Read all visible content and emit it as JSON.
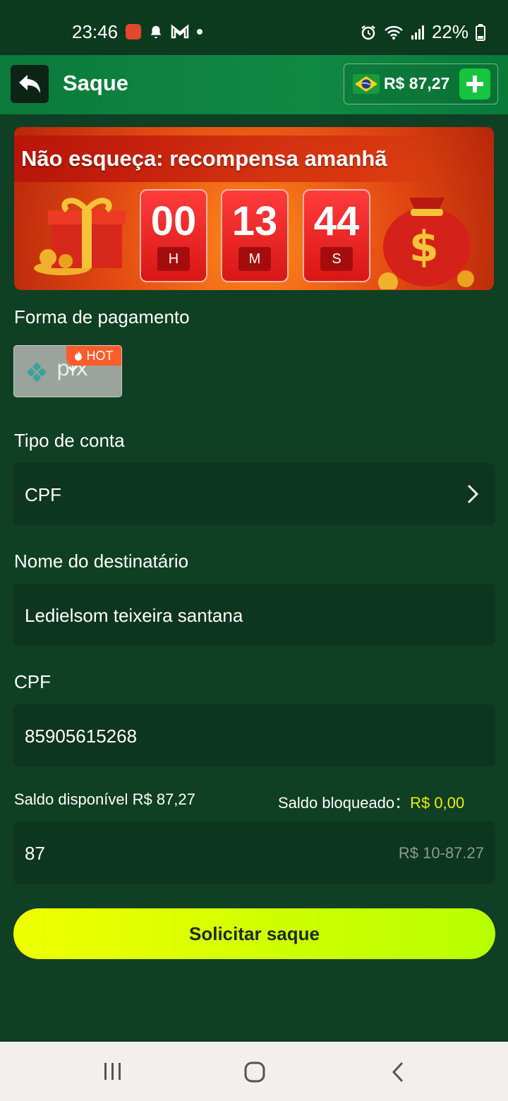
{
  "status_bar": {
    "time": "23:46",
    "battery": "22%",
    "icons_left": [
      "notification-app-icon",
      "bell-icon",
      "gmail-icon",
      "dot-icon"
    ],
    "icons_right": [
      "alarm-icon",
      "wifi-icon",
      "signal-icon",
      "battery-icon"
    ]
  },
  "header": {
    "title": "Saque",
    "balance": "R$ 87,27"
  },
  "banner": {
    "title": "Não esqueça: recompensa amanhã",
    "timer": [
      {
        "value": "00",
        "unit": "H"
      },
      {
        "value": "13",
        "unit": "M"
      },
      {
        "value": "44",
        "unit": "S"
      }
    ]
  },
  "payment": {
    "label": "Forma de pagamento",
    "method": "pix",
    "hot_tag": "HOT"
  },
  "account_type": {
    "label": "Tipo de conta",
    "value": "CPF"
  },
  "recipient": {
    "label": "Nome do destinatário",
    "value": "Ledielsom teixeira santana"
  },
  "cpf": {
    "label": "CPF",
    "value": "85905615268"
  },
  "balances": {
    "available_label": "Saldo disponível",
    "available_value": "R$ 87,27",
    "blocked_label": "Saldo bloqueado：",
    "blocked_value": "R$ 0,00"
  },
  "amount": {
    "value": "87",
    "range_hint": "R$ 10-87.27"
  },
  "submit": {
    "label": "Solicitar saque"
  },
  "colors": {
    "background": "#0f3f24",
    "header": "#0f8a43",
    "field": "#0d3520",
    "button": "#d8ff00",
    "blocked_value": "#ecf000"
  }
}
